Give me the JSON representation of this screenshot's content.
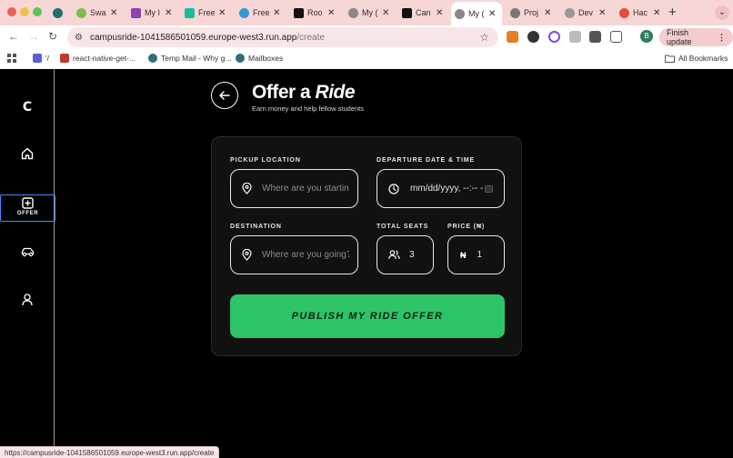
{
  "browser": {
    "tabs": [
      {
        "label": "Swa",
        "color": "#7bc043"
      },
      {
        "label": "My I",
        "color": "#8e44ad"
      },
      {
        "label": "Free",
        "color": "#1abc9c"
      },
      {
        "label": "Free",
        "color": "#3498db"
      },
      {
        "label": "Roo",
        "color": "#111111"
      },
      {
        "label": "My (",
        "color": "#888888"
      },
      {
        "label": "Can",
        "color": "#111111"
      },
      {
        "label": "My (",
        "color": "#888888"
      },
      {
        "label": "Proj",
        "color": "#777777"
      },
      {
        "label": "Dev",
        "color": "#999999"
      },
      {
        "label": "Hac",
        "color": "#e74c3c"
      }
    ],
    "active_tab_index": 7,
    "url_host": "campusride-1041586501059.europe-west3.run.app",
    "url_path": "/create",
    "finish_update_label": "Finish update",
    "profile_initial": "B",
    "bookmarks": [
      {
        "label": "'/",
        "color": "#5b5fd6"
      },
      {
        "label": "react-native-get-...",
        "color": "#c0392b"
      },
      {
        "label": "Temp Mail - Why g...",
        "color": "#2c6e7a"
      },
      {
        "label": "Mailboxes",
        "color": "#2c6e7a"
      }
    ],
    "all_bookmarks_label": "All Bookmarks",
    "status_url": "https://campusride-1041586501059.europe-west3.run.app/create"
  },
  "sidebar": {
    "logo": "C",
    "offer_label": "OFFER"
  },
  "header": {
    "title_prefix": "Offer a",
    "title_emph": "Ride",
    "subtitle": "Earn money and help fellow students"
  },
  "form": {
    "pickup_label": "PICKUP LOCATION",
    "pickup_placeholder": "Where are you starting?",
    "departure_label": "DEPARTURE DATE & TIME",
    "departure_value": "mm/dd/yyyy, --:-- --",
    "destination_label": "DESTINATION",
    "destination_placeholder": "Where are you going?",
    "seats_label": "TOTAL SEATS",
    "seats_value": "3",
    "price_label": "PRICE (₦)",
    "price_symbol": "₦",
    "price_value": "1",
    "publish_label": "PUBLISH MY RIDE OFFER"
  },
  "colors": {
    "accent": "#2dc467",
    "active_nav_outline": "#3d8bfd"
  }
}
